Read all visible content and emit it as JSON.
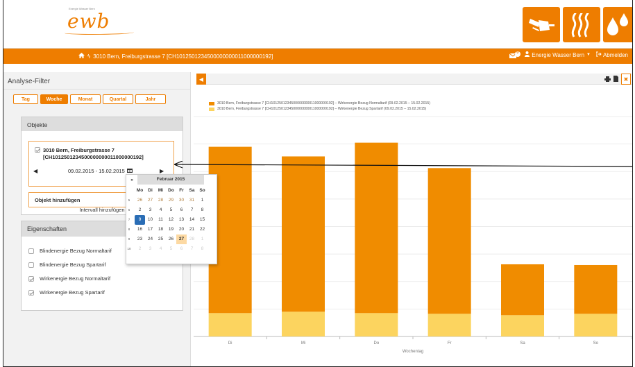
{
  "header": {
    "logo_small": "Energie Wasser Bern",
    "logo_text": "ewb",
    "tiles": [
      "plug-icon",
      "heat-icon",
      "water-drops-icon"
    ]
  },
  "nav": {
    "address": "3010 Bern, Freiburgstrasse 7 [CH1012501234500000000011000000192]",
    "mail_count": "0",
    "user": "Energie Wasser Bern",
    "logout": "Abmelden"
  },
  "sidebar": {
    "title": "Analyse-Filter",
    "periods": [
      {
        "label": "Tag",
        "active": false
      },
      {
        "label": "Woche",
        "active": true
      },
      {
        "label": "Monat",
        "active": false
      },
      {
        "label": "Quartal",
        "active": false
      },
      {
        "label": "Jahr",
        "active": false
      }
    ],
    "objekte": {
      "title": "Objekte",
      "object_line1": "3010 Bern, Freiburgstrasse 7",
      "object_line2": "[CH1012501234500000000011000000192]",
      "date_range": "09.02.2015 - 15.02.2015",
      "add_interval": "Intervall hinzufügen",
      "add_object": "Objekt hinzufügen"
    },
    "eigenschaften": {
      "title": "Eigenschaften",
      "items": [
        {
          "label": "Blindenergie Bezug Normaltarif",
          "checked": false
        },
        {
          "label": "Blindenergie Bezug Spartarif",
          "checked": false
        },
        {
          "label": "Wirkenergie Bezug Normaltarif",
          "checked": true
        },
        {
          "label": "Wirkenergie Bezug Spartarif",
          "checked": true
        }
      ]
    }
  },
  "calendar": {
    "prev": "«",
    "title": "Februar 2015",
    "weekdays": [
      "Mo",
      "Di",
      "Mi",
      "Do",
      "Fr",
      "Sa",
      "So"
    ],
    "weeks": [
      {
        "wk": "5",
        "days": [
          "26",
          "27",
          "28",
          "29",
          "30",
          "31",
          "1"
        ],
        "other": [
          true,
          true,
          true,
          true,
          true,
          true,
          false
        ]
      },
      {
        "wk": "6",
        "days": [
          "2",
          "3",
          "4",
          "5",
          "6",
          "7",
          "8"
        ],
        "other": [
          false,
          false,
          false,
          false,
          false,
          false,
          false
        ]
      },
      {
        "wk": "7",
        "days": [
          "9",
          "10",
          "11",
          "12",
          "13",
          "14",
          "15"
        ],
        "other": [
          false,
          false,
          false,
          false,
          false,
          false,
          false
        ]
      },
      {
        "wk": "8",
        "days": [
          "16",
          "17",
          "18",
          "19",
          "20",
          "21",
          "22"
        ],
        "other": [
          false,
          false,
          false,
          false,
          false,
          false,
          false
        ]
      },
      {
        "wk": "9",
        "days": [
          "23",
          "24",
          "25",
          "26",
          "27",
          "28",
          "1"
        ],
        "other": [
          false,
          false,
          false,
          false,
          false,
          true,
          true
        ]
      },
      {
        "wk": "10",
        "days": [
          "2",
          "3",
          "4",
          "5",
          "6",
          "7",
          "8"
        ],
        "other": [
          true,
          true,
          true,
          true,
          true,
          true,
          true
        ]
      }
    ],
    "selected": "9",
    "today": "27"
  },
  "colors": {
    "accent": "#ee7d00",
    "normal": "#f08c00",
    "spar": "#fcd45f",
    "selected": "#2a6db5"
  },
  "chart_data": {
    "type": "bar",
    "stacked": true,
    "categories": [
      "Di",
      "Mi",
      "Do",
      "Fr",
      "Sa",
      "So"
    ],
    "xlabel": "Wochentag",
    "series": [
      {
        "name": "3010 Bern, Freiburgstrasse 7 [CH1012501234500000000011000000192] – Wirkenergie Bezug Normaltarif (09.02.2015 – 15.02.2015)",
        "values": [
          242,
          226,
          248,
          212,
          74,
          71
        ]
      },
      {
        "name": "3010 Bern, Freiburgstrasse 7 [CH1012501234500000000011000000192] – Wirkenergie Bezug Spartarif (09.02.2015 – 15.02.2015)",
        "values": [
          34,
          36,
          34,
          33,
          31,
          33
        ]
      }
    ],
    "ylim": [
      0,
      320
    ],
    "grid": true,
    "legend_position": "top-left"
  }
}
